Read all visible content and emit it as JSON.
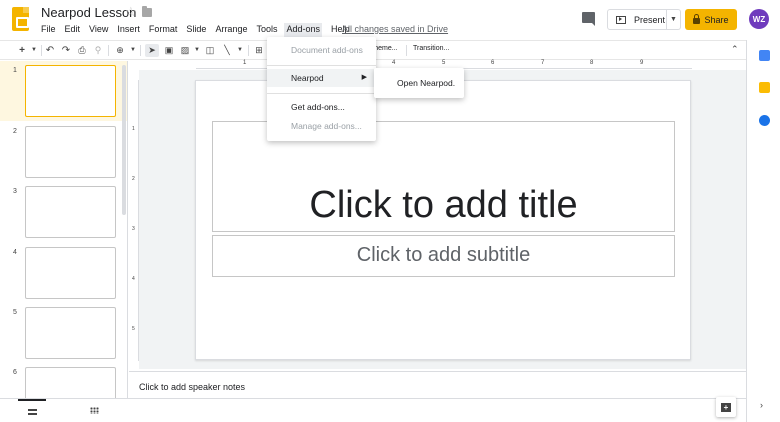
{
  "app": {
    "title": "Nearpod Lesson",
    "saved_status": "All changes saved in Drive"
  },
  "menubar": [
    "File",
    "Edit",
    "View",
    "Insert",
    "Format",
    "Slide",
    "Arrange",
    "Tools",
    "Add-ons",
    "Help"
  ],
  "header": {
    "present_label": "Present",
    "share_label": "Share",
    "avatar_initials": "WZ"
  },
  "toolbar": {
    "theme_label": "Theme...",
    "transition_label": "Transition..."
  },
  "ruler": [
    "1",
    "2",
    "3",
    "4",
    "5",
    "6",
    "7",
    "8",
    "9"
  ],
  "vruler": [
    "1",
    "2",
    "3",
    "4",
    "5"
  ],
  "filmstrip": {
    "slides": [
      "1",
      "2",
      "3",
      "4",
      "5",
      "6"
    ],
    "selected": 1
  },
  "slide": {
    "title_placeholder": "Click to add title",
    "subtitle_placeholder": "Click to add subtitle"
  },
  "notes": {
    "placeholder": "Click to add speaker notes"
  },
  "addons_menu": {
    "document_addons": "Document add-ons",
    "nearpod": "Nearpod",
    "get_addons": "Get add-ons...",
    "manage_addons": "Manage add-ons..."
  },
  "nearpod_submenu": {
    "open": "Open Nearpod."
  },
  "colors": {
    "accent": "#f4b400",
    "avatar": "#6f3bbd",
    "canvas_bg": "#f1f3f4"
  }
}
